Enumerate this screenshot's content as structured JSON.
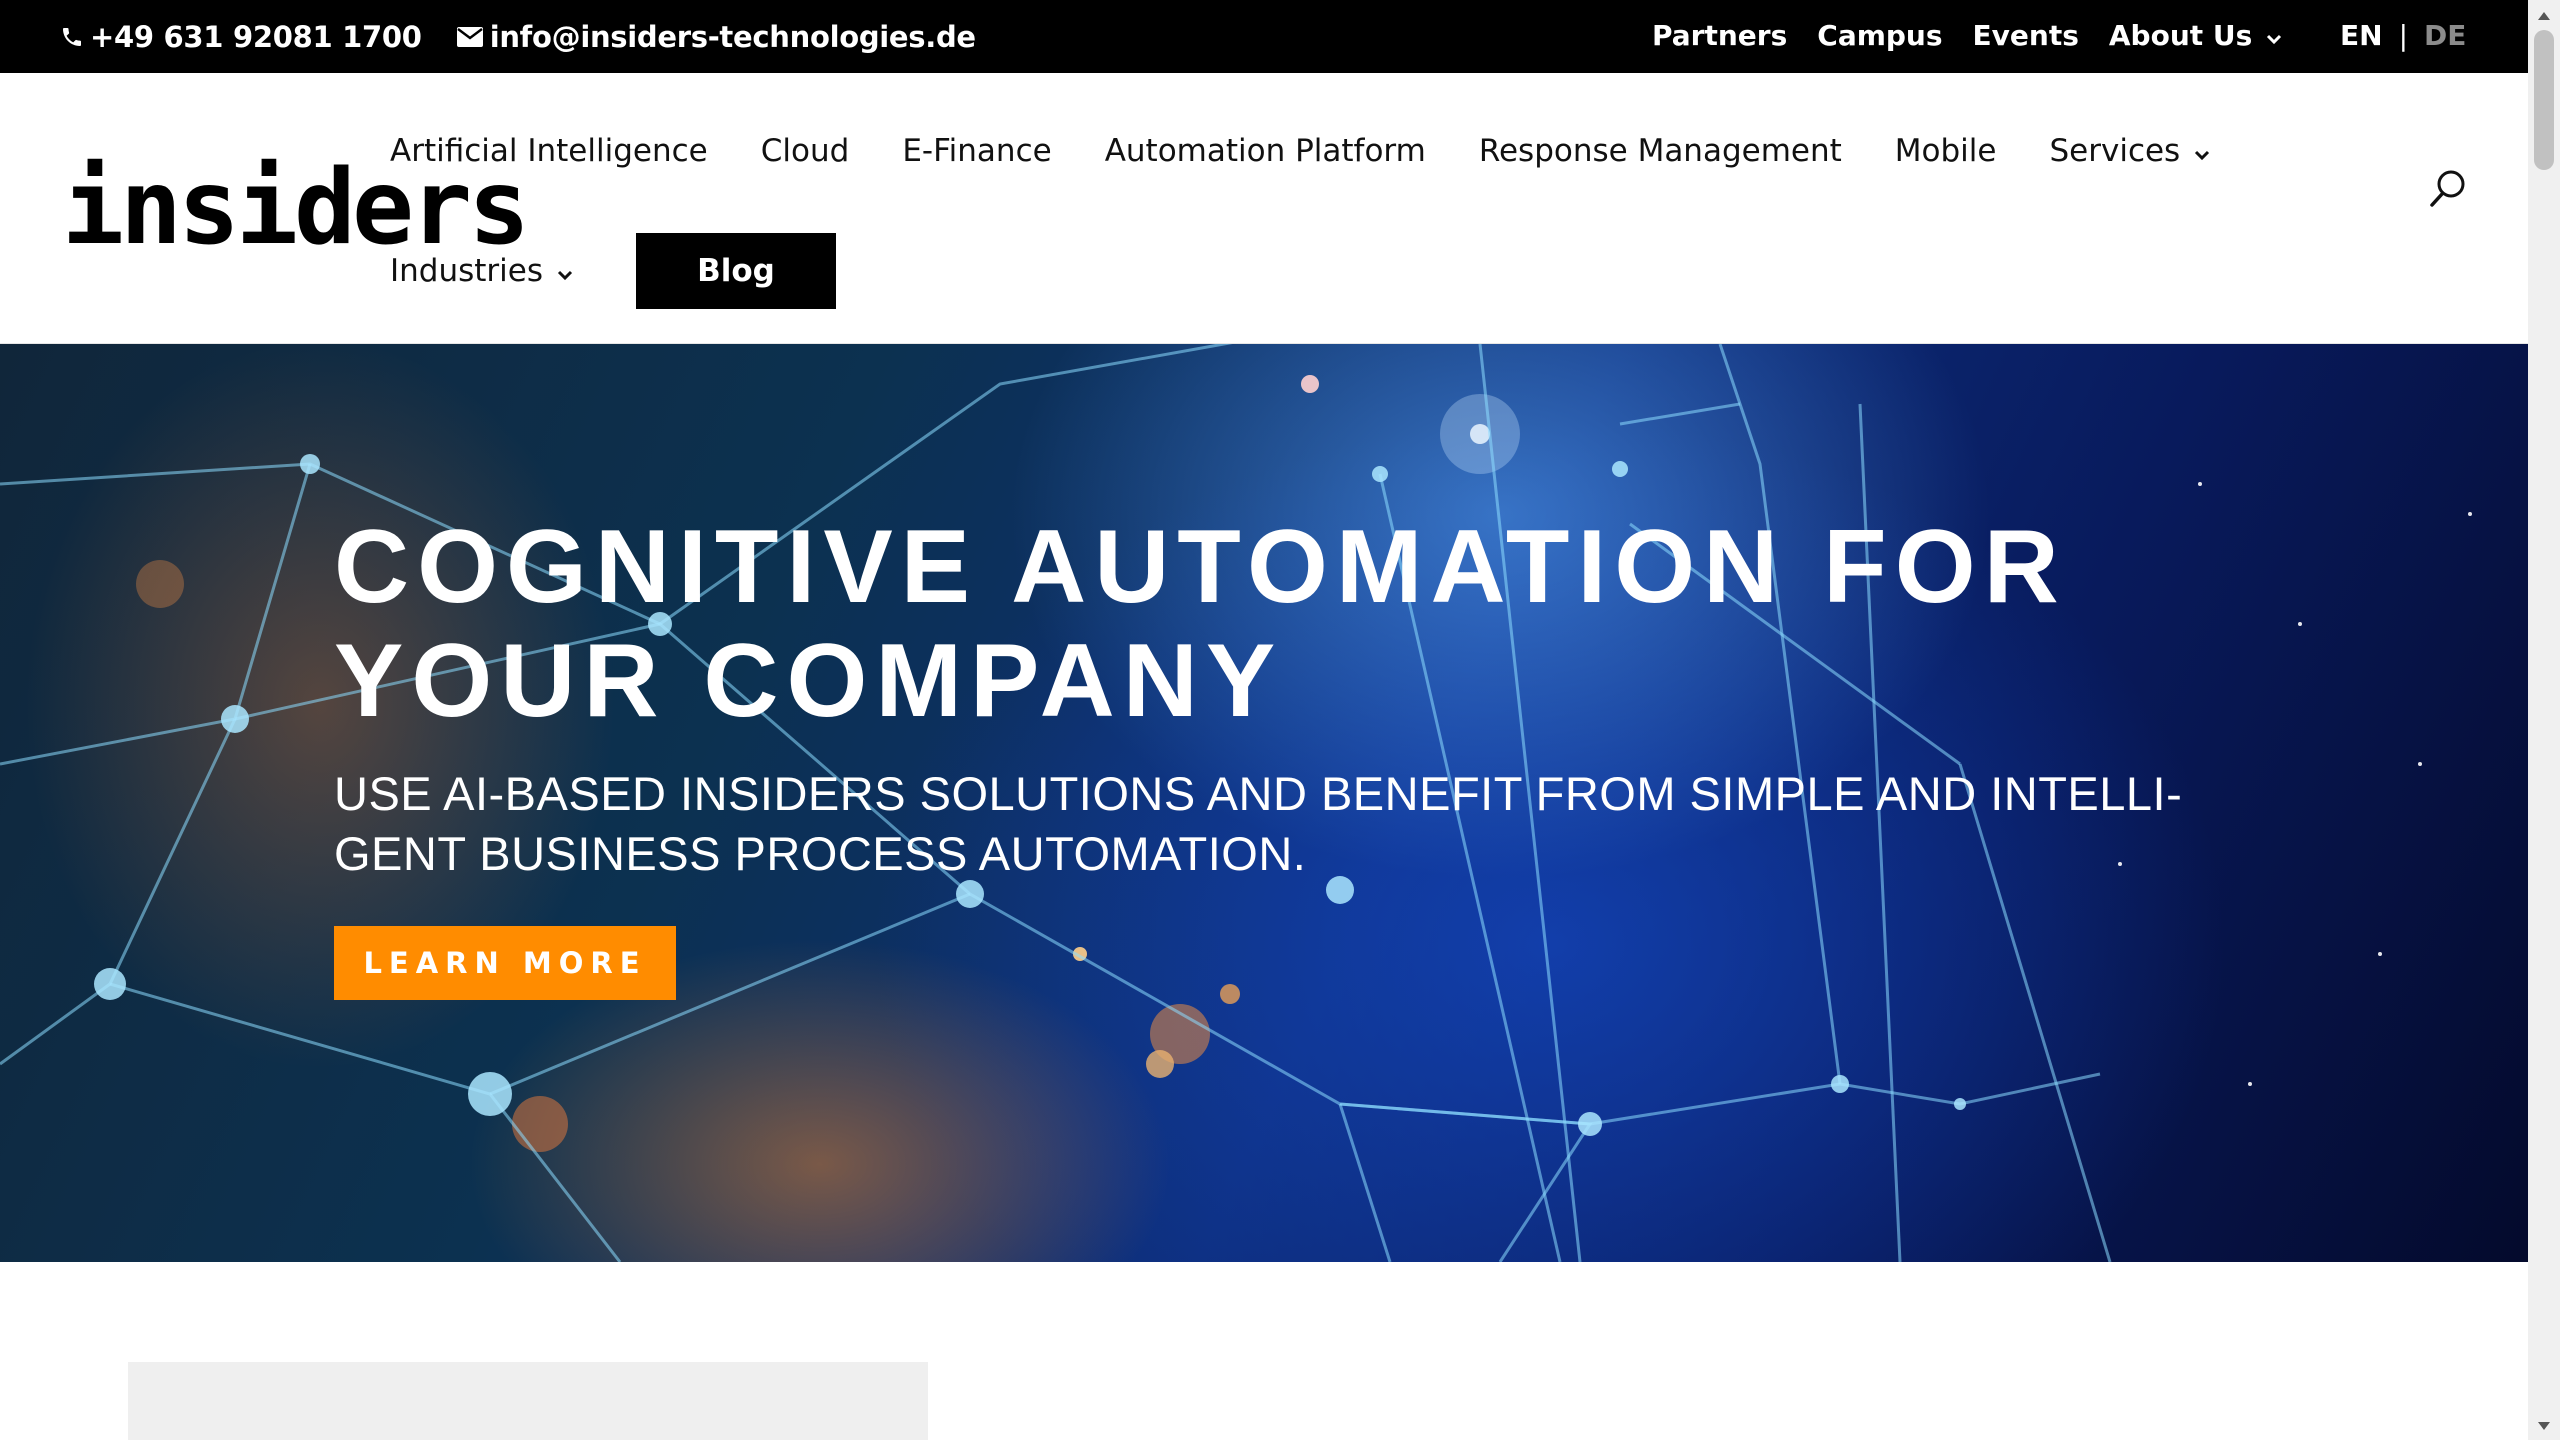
{
  "topbar": {
    "phone": "+49 631 92081 1700",
    "email": "info@insiders-technologies.de",
    "links": [
      "Partners",
      "Campus",
      "Events",
      "About Us"
    ],
    "lang_en": "EN",
    "lang_sep": "|",
    "lang_de": "DE"
  },
  "header": {
    "logo": "insiders",
    "nav": [
      "Artificial Intelligence",
      "Cloud",
      "E-Finance",
      "Automation Platform",
      "Response Management",
      "Mobile",
      "Services"
    ],
    "nav_second": "Industries",
    "blog": "Blog",
    "icons": {
      "search": "search-icon",
      "dropdown": "chevron-down-icon",
      "phone": "phone-icon",
      "email": "envelope-icon"
    }
  },
  "hero": {
    "title": "COGNITIVE AUTOMATION FOR YOUR COMPANY",
    "subtitle": "USE AI-BASED INSIDERS SOLUTIONS AND BENEFIT FROM SIMPLE AND INTELLI-GENT BUSINESS PROCESS AUTOMATION.",
    "cta": "LEARN MORE"
  },
  "colors": {
    "topbar_bg": "#000000",
    "accent": "#ff8c00",
    "lang_inactive": "#8b8b8b"
  }
}
